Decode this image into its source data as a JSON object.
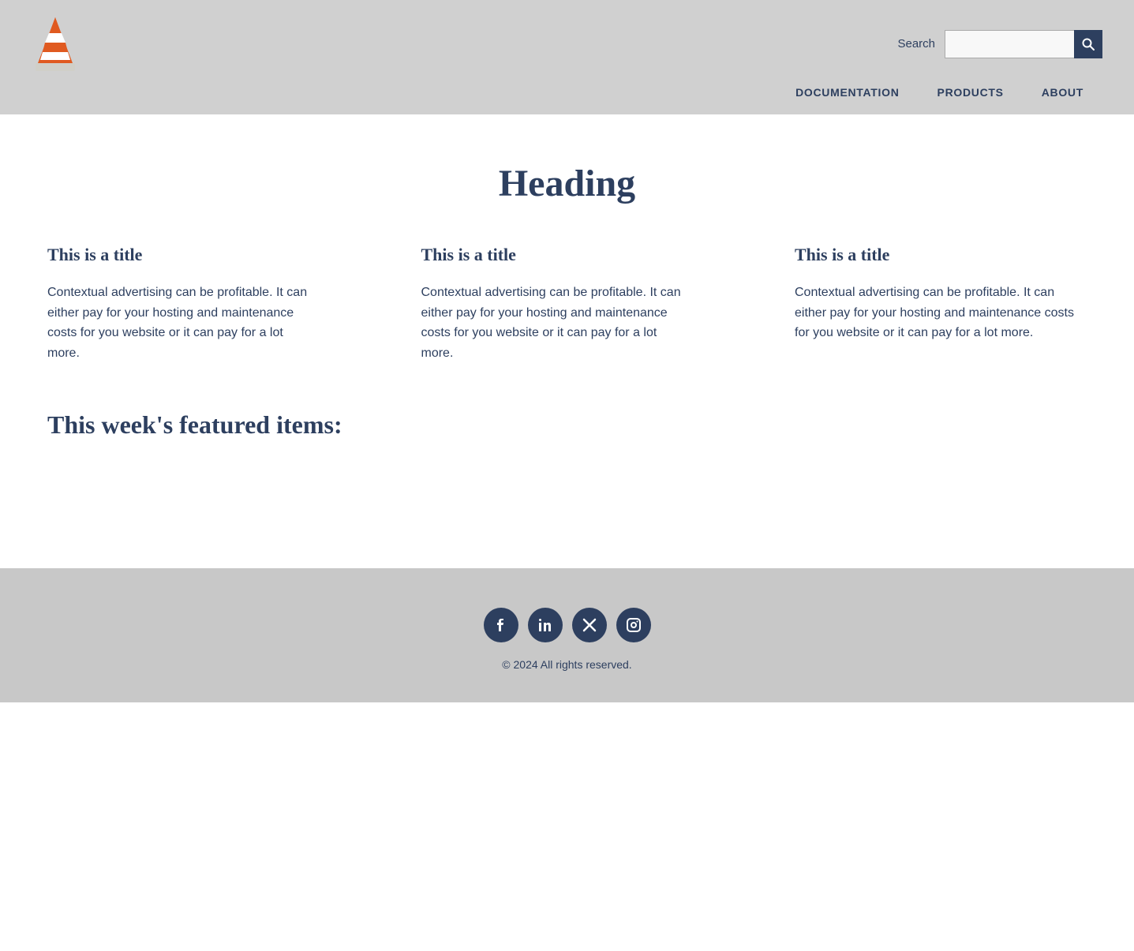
{
  "header": {
    "search_label": "Search",
    "search_placeholder": "",
    "nav_items": [
      {
        "label": "DOCUMENTATION",
        "key": "documentation"
      },
      {
        "label": "PRODUCTS",
        "key": "products"
      },
      {
        "label": "ABOUT",
        "key": "about"
      }
    ]
  },
  "main": {
    "heading": "Heading",
    "cards": [
      {
        "title": "This is a title",
        "text": "Contextual advertising can be profitable. It can either pay for your hosting and maintenance costs for you website or it can pay for a lot more."
      },
      {
        "title": "This is a title",
        "text": "Contextual advertising can be profitable. It can either pay for your hosting and maintenance costs for you website or it can pay for a lot more."
      },
      {
        "title": "This is a title",
        "text": "Contextual advertising can be profitable. It can either pay for your hosting and maintenance costs for you website or it can pay for a lot more."
      }
    ],
    "featured_heading": "This week's featured items:"
  },
  "footer": {
    "social_icons": [
      {
        "name": "facebook",
        "symbol": "f"
      },
      {
        "name": "linkedin",
        "symbol": "in"
      },
      {
        "name": "x-twitter",
        "symbol": "✕"
      },
      {
        "name": "instagram",
        "symbol": "◎"
      }
    ],
    "copyright": "© 2024 All rights reserved."
  }
}
